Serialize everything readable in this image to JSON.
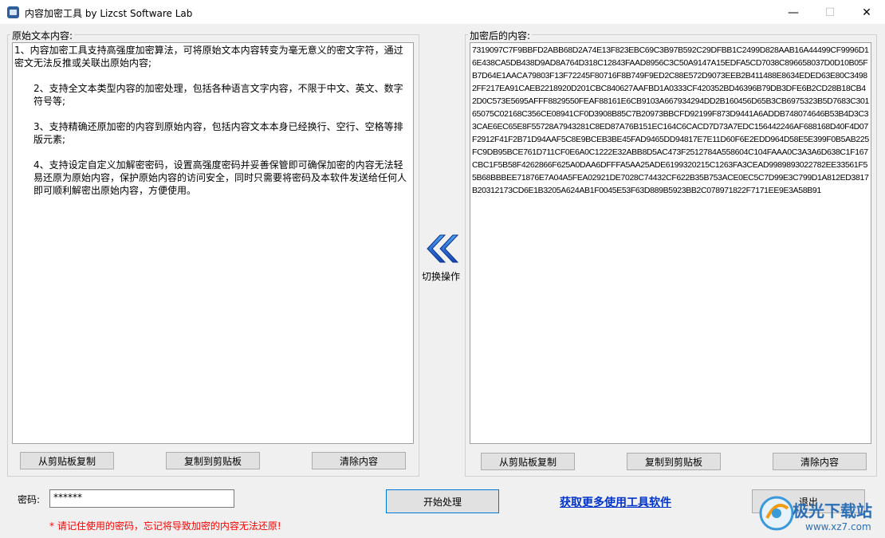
{
  "window": {
    "title": "内容加密工具  by Lizcst Software Lab",
    "minimize": "—",
    "maximize": "☐",
    "close": "✕"
  },
  "left_panel": {
    "label": "原始文本内容:",
    "paragraphs": [
      "1、内容加密工具支持高强度加密算法，可将原始文本内容转变为毫无意义的密文字符，通过密文无法反推或关联出原始内容;",
      "2、支持全文本类型内容的加密处理，包括各种语言文字内容，不限于中文、英文、数字符号等;",
      "3、支持精确还原加密的内容到原始内容，包括内容文本本身已经换行、空行、空格等排版元素;",
      "4、支持设定自定义加解密密码，设置高强度密码并妥善保管即可确保加密的内容无法轻易还原为原始内容，保护原始内容的访问安全，同时只需要将密码及本软件发送给任何人即可顺利解密出原始内容，方便使用。"
    ],
    "buttons": {
      "paste": "从剪贴板复制",
      "copy": "复制到剪贴板",
      "clear": "清除内容"
    }
  },
  "right_panel": {
    "label": "加密后的内容:",
    "content": "7319097C7F9BBFD2ABB68D2A74E13F823EBC69C3B97B592C29DFBB1C2499D828AAB16A44499CF9996D16E438CA5DB438D9AD8A764D318C12843FAAD8956C3C50A9147A15EDFA5CD7038C896658037D0D10B05FB7D64E1AACA79803F13F72245F80716F8B749F9ED2C88E572D9073EEB2B411488E8634EDED63E80C34982FF217EA91CAEB2218920D201CBC840627AAFBD1A0333CF420352BD46396B79DB3DFE6B2CD28B18CB42D0C573E5695AFFF8829550FEAF88161E6CB9103A667934294DD2B160456D65B3CB6975323B5D7683C30165075C02168C356CE08941CF0D3908B85C7B20973BBCFD92199F873D9441A6ADDB748074646B53B4D3C33CAE6EC65E8F55728A7943281C8ED87A76B151EC164C6CACD7D73A7EDC156442246AF688168D40F4D07F2912F41F2B71D94AAF5C8E9BCEB3BE45FAD9465DD94817E7E11D60F6E2EDD964D58E5E399F0B5AB225FC9DB95BCE761D711CF0E6A0C1222E32ABB8D5AC473F2512784A558604C104FAAA0C3A3A6D638C1F167CBC1F5B58F4262866F625A0DAA6DFFFA5AA25ADE6199320215C1263FA3CEAD9989893022782EE33561F55B68BBBEE71876E7A04A5FEA02921DE7028C74432CF622B35B753ACE0EC5C7D99E3C799D1A812ED3817B20312173CD6E1B3205A624AB1F0045E53F63D889B5923BB2C078971822F7171EE9E3A58B91",
    "buttons": {
      "paste": "从剪贴板复制",
      "copy": "复制到剪贴板",
      "clear": "清除内容"
    }
  },
  "switch": {
    "label": "切换操作",
    "icon": "double-chevron-left-icon"
  },
  "password": {
    "label": "密码:",
    "value": "******",
    "warning": "* 请记住使用的密码，忘记将导致加密的内容无法还原!"
  },
  "actions": {
    "start": "开始处理",
    "more_link": "获取更多使用工具软件",
    "exit": "退出"
  },
  "watermark": {
    "text": "极光下载站",
    "url": "www.xz7.com"
  },
  "colors": {
    "accent_blue": "#0078d7",
    "link": "#0033cc",
    "warning": "#ff0000",
    "icon_blue": "#1e5bc6"
  }
}
